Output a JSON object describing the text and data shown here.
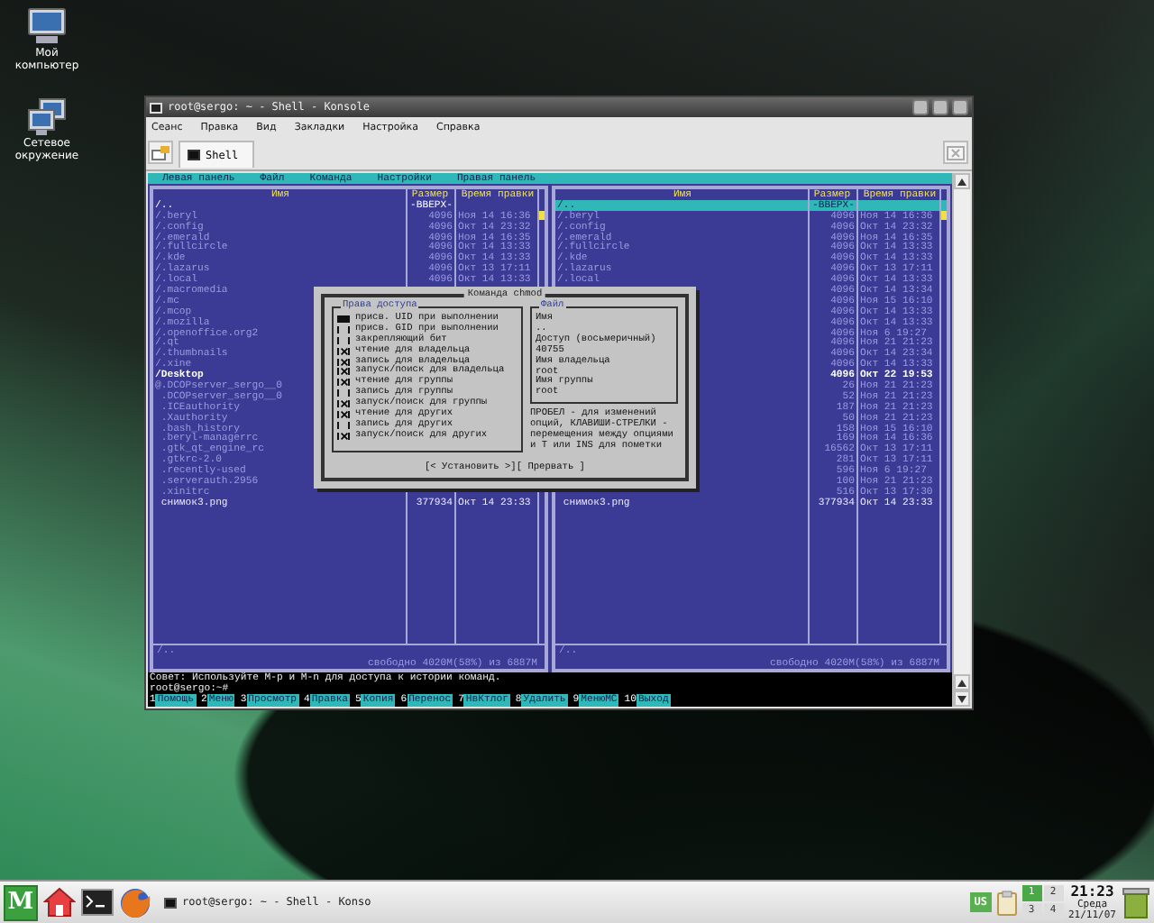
{
  "desktop_icons": [
    {
      "label": "Мой компьютер",
      "kind": "computer"
    },
    {
      "label": "Сетевое окружение",
      "kind": "network"
    }
  ],
  "window": {
    "title": "root@sergo: ~ - Shell - Konsole",
    "menu": [
      "Сеанс",
      "Правка",
      "Вид",
      "Закладки",
      "Настройка",
      "Справка"
    ],
    "tabs": [
      {
        "label": "Shell",
        "selected": true
      }
    ]
  },
  "terminal": {
    "menu": [
      "Левая панель",
      "Файл",
      "Команда",
      "Настройки",
      "Правая панель"
    ],
    "panels": [
      {
        "columns": [
          "Имя",
          "Размер",
          "Время правки"
        ],
        "rows": [
          {
            "name": "/..",
            "size": "-ВВЕРХ-",
            "kind": "updir",
            "selected": false
          },
          {
            "name": "/.beryl",
            "size": "4096",
            "time": "Ноя 14 16:36",
            "kind": "entry",
            "selected": false
          },
          {
            "name": "/.config",
            "size": "4096",
            "time": "Окт 14 23:32",
            "kind": "entry",
            "selected": false
          },
          {
            "name": "/.emerald",
            "size": "4096",
            "time": "Ноя 14 16:35",
            "kind": "entry",
            "selected": false
          },
          {
            "name": "/.fullcircle",
            "size": "4096",
            "time": "Окт 14 13:33",
            "kind": "entry",
            "selected": false
          },
          {
            "name": "/.kde",
            "size": "4096",
            "time": "Окт 14 13:33",
            "kind": "entry",
            "selected": false
          },
          {
            "name": "/.lazarus",
            "size": "4096",
            "time": "Окт 13 17:11",
            "kind": "entry",
            "selected": false
          },
          {
            "name": "/.local",
            "size": "4096",
            "time": "Окт 14 13:33",
            "kind": "entry",
            "selected": false
          },
          {
            "name": "/.macromedia",
            "kind": "entry",
            "selected": false
          },
          {
            "name": "/.mc",
            "kind": "entry",
            "selected": false
          },
          {
            "name": "/.mcop",
            "kind": "entry",
            "selected": false
          },
          {
            "name": "/.mozilla",
            "kind": "entry",
            "selected": false
          },
          {
            "name": "/.openoffice.org2",
            "kind": "entry",
            "selected": false
          },
          {
            "name": "/.qt",
            "kind": "entry",
            "selected": false
          },
          {
            "name": "/.thumbnails",
            "kind": "entry",
            "selected": false
          },
          {
            "name": "/.xine",
            "kind": "entry",
            "selected": false
          },
          {
            "name": "/Desktop",
            "kind": "bright",
            "selected": false
          },
          {
            "name": "@.DCOPserver_sergo__0",
            "kind": "entry",
            "selected": false
          },
          {
            "name": " .DCOPserver_sergo__0",
            "kind": "entry",
            "selected": false
          },
          {
            "name": " .ICEauthority",
            "kind": "entry",
            "selected": false
          },
          {
            "name": " .Xauthority",
            "kind": "entry",
            "selected": false
          },
          {
            "name": " .bash_history",
            "kind": "entry",
            "selected": false
          },
          {
            "name": " .beryl-managerrc",
            "kind": "entry",
            "selected": false
          },
          {
            "name": " .gtk_qt_engine_rc",
            "kind": "entry",
            "selected": false
          },
          {
            "name": " .gtkrc-2.0",
            "kind": "entry",
            "selected": false
          },
          {
            "name": " .recently-used",
            "kind": "entry",
            "selected": false
          },
          {
            "name": " .serverauth.2956",
            "kind": "entry",
            "selected": false
          },
          {
            "name": " .xinitrc",
            "kind": "entry",
            "selected": false
          },
          {
            "name": " снимок3.png",
            "size": "377934",
            "time": "Окт 14 23:33",
            "kind": "file",
            "selected": false
          }
        ],
        "mini_status": "/..",
        "free_space": "свободно 4020M(58%) из 6887M"
      },
      {
        "columns": [
          "Имя",
          "Размер",
          "Время правки"
        ],
        "rows": [
          {
            "name": "/..",
            "size": "-ВВЕРХ-",
            "kind": "updir",
            "selected": true
          },
          {
            "name": "/.beryl",
            "size": "4096",
            "time": "Ноя 14 16:36",
            "kind": "entry",
            "selected": false
          },
          {
            "name": "/.config",
            "size": "4096",
            "time": "Окт 14 23:32",
            "kind": "entry",
            "selected": false
          },
          {
            "name": "/.emerald",
            "size": "4096",
            "time": "Ноя 14 16:35",
            "kind": "entry",
            "selected": false
          },
          {
            "name": "/.fullcircle",
            "size": "4096",
            "time": "Окт 14 13:33",
            "kind": "entry",
            "selected": false
          },
          {
            "name": "/.kde",
            "size": "4096",
            "time": "Окт 14 13:33",
            "kind": "entry",
            "selected": false
          },
          {
            "name": "/.lazarus",
            "size": "4096",
            "time": "Окт 13 17:11",
            "kind": "entry",
            "selected": false
          },
          {
            "name": "/.local",
            "size": "4096",
            "time": "Окт 14 13:33",
            "kind": "entry",
            "selected": false
          },
          {
            "size": "4096",
            "time": "Окт 14 13:34",
            "kind": "entry",
            "selected": false
          },
          {
            "size": "4096",
            "time": "Ноя 15 16:10",
            "kind": "entry",
            "selected": false
          },
          {
            "size": "4096",
            "time": "Окт 14 13:33",
            "kind": "entry",
            "selected": false
          },
          {
            "size": "4096",
            "time": "Окт 14 13:33",
            "kind": "entry",
            "selected": false
          },
          {
            "size": "4096",
            "time": "Ноя 6 19:27",
            "kind": "entry",
            "selected": false
          },
          {
            "size": "4096",
            "time": "Ноя 21 21:23",
            "kind": "entry",
            "selected": false
          },
          {
            "size": "4096",
            "time": "Окт 14 23:34",
            "kind": "entry",
            "selected": false
          },
          {
            "size": "4096",
            "time": "Окт 14 13:33",
            "kind": "entry",
            "selected": false
          },
          {
            "size": "4096",
            "time": "Окт 22 19:53",
            "kind": "bright",
            "selected": false
          },
          {
            "size": "26",
            "time": "Ноя 21 21:23",
            "kind": "entry",
            "selected": false
          },
          {
            "size": "52",
            "time": "Ноя 21 21:23",
            "kind": "entry",
            "selected": false
          },
          {
            "size": "187",
            "time": "Ноя 21 21:23",
            "kind": "entry",
            "selected": false
          },
          {
            "size": "50",
            "time": "Ноя 21 21:23",
            "kind": "entry",
            "selected": false
          },
          {
            "size": "158",
            "time": "Ноя 15 16:10",
            "kind": "entry",
            "selected": false
          },
          {
            "size": "169",
            "time": "Ноя 14 16:36",
            "kind": "entry",
            "selected": false
          },
          {
            "size": "16562",
            "time": "Окт 13 17:11",
            "kind": "entry",
            "selected": false
          },
          {
            "size": "281",
            "time": "Окт 13 17:11",
            "kind": "entry",
            "selected": false
          },
          {
            "size": "596",
            "time": "Ноя 6 19:27",
            "kind": "entry",
            "selected": false
          },
          {
            "size": "100",
            "time": "Ноя 21 21:23",
            "kind": "entry",
            "selected": false
          },
          {
            "size": "516",
            "time": "Окт 13 17:30",
            "kind": "entry",
            "selected": false
          },
          {
            "name": " снимок3.png",
            "size": "377934",
            "time": "Окт 14 23:33",
            "kind": "file",
            "selected": false
          }
        ],
        "mini_status": "/..",
        "free_space": "свободно 4020M(58%) из 6887M"
      }
    ],
    "hint": "Совет: Используйте M-p и M-n для доступа к истории команд.",
    "prompt": "root@sergo:~#",
    "function_keys": [
      {
        "key": "1",
        "label": "Помощь"
      },
      {
        "key": "2",
        "label": "Меню"
      },
      {
        "key": "3",
        "label": "Просмотр"
      },
      {
        "key": "4",
        "label": "Правка"
      },
      {
        "key": "5",
        "label": "Копия"
      },
      {
        "key": "6",
        "label": "Перенос"
      },
      {
        "key": "7",
        "label": "НвКтлог"
      },
      {
        "key": "8",
        "label": "Удалить"
      },
      {
        "key": "9",
        "label": "МенюМС"
      },
      {
        "key": "10",
        "label": "Выход"
      }
    ]
  },
  "dialog": {
    "title": "Команда chmod",
    "permissions": {
      "title": "Права доступа",
      "items": [
        {
          "label": "присв. UID при выполнении",
          "checked": false,
          "focused": true
        },
        {
          "label": "присв. GID при выполнении",
          "checked": false,
          "focused": false
        },
        {
          "label": "закрепляющий бит",
          "checked": false,
          "focused": false
        },
        {
          "label": "чтение для владельца",
          "checked": true,
          "focused": false
        },
        {
          "label": "запись для владельца",
          "checked": true,
          "focused": false
        },
        {
          "label": "запуск/поиск для владельца",
          "checked": true,
          "focused": false
        },
        {
          "label": "чтение для группы",
          "checked": true,
          "focused": false
        },
        {
          "label": "запись для группы",
          "checked": false,
          "focused": false
        },
        {
          "label": "запуск/поиск для группы",
          "checked": true,
          "focused": false
        },
        {
          "label": "чтение для других",
          "checked": true,
          "focused": false
        },
        {
          "label": "запись для других",
          "checked": false,
          "focused": false
        },
        {
          "label": "запуск/поиск для других",
          "checked": true,
          "focused": false
        }
      ]
    },
    "file": {
      "title": "Файл",
      "fields": [
        {
          "label": "Имя",
          "value": ".."
        },
        {
          "label": "Доступ (восьмеричный)",
          "value": "40755"
        },
        {
          "label": "Имя владельца",
          "value": "root"
        },
        {
          "label": "Имя группы",
          "value": "root"
        }
      ]
    },
    "help": "ПРОБЕЛ - для изменений опций, КЛАВИШИ-СТРЕЛКИ - перемещения между опциями и T или INS для пометки",
    "buttons": [
      "[< Установить >]",
      "[ Прервать ]"
    ]
  },
  "taskbar": {
    "menu_label": "M",
    "launchers": [
      {
        "kind": "home"
      },
      {
        "kind": "terminal"
      },
      {
        "kind": "browser"
      }
    ],
    "task": "root@sergo: ~ - Shell - Konso",
    "keyboard": "US",
    "desktops": [
      {
        "label": "1",
        "selected": true
      },
      {
        "label": "2",
        "selected": false
      },
      {
        "label": "3",
        "selected": false
      },
      {
        "label": "4",
        "selected": false
      }
    ],
    "clock": {
      "time": "21:23",
      "day": "Среда",
      "date": "21/11/07"
    }
  }
}
